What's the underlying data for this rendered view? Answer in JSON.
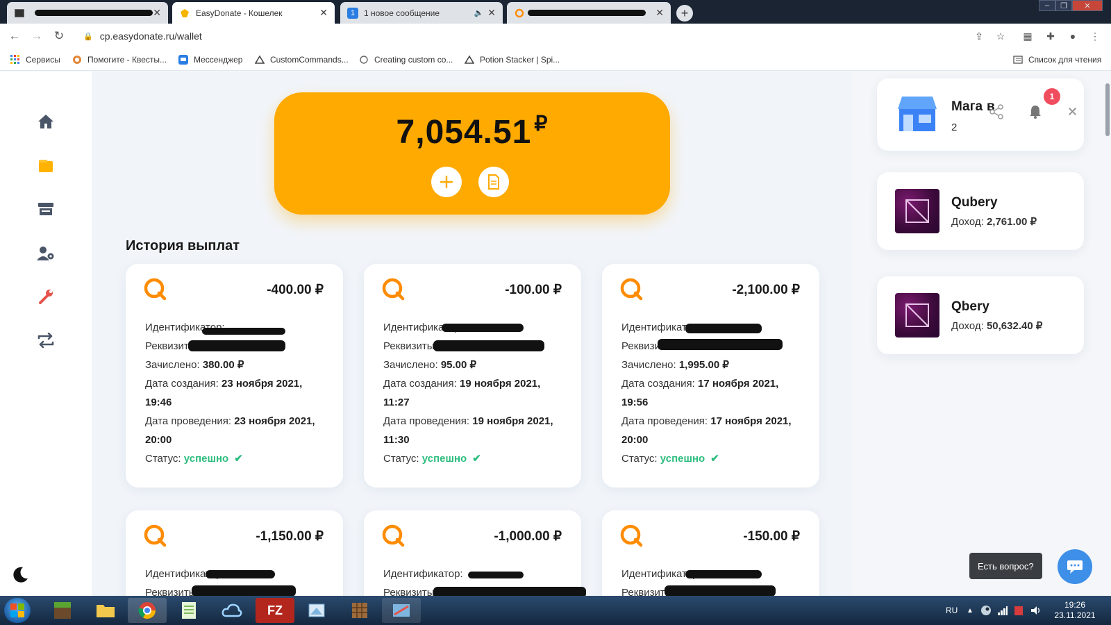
{
  "browser": {
    "tabs": [
      {
        "title": "",
        "active": false
      },
      {
        "title": "EasyDonate - Кошелек",
        "active": true
      },
      {
        "title": "1 новое сообщение",
        "active": false,
        "favicon_text": "1"
      },
      {
        "title": "",
        "active": false
      }
    ],
    "url": "cp.easydonate.ru/wallet",
    "bookmarks": [
      {
        "label": "Сервисы",
        "icon": "apps-grid-icon"
      },
      {
        "label": "Помогите - Квесты...",
        "icon": "spigot-icon"
      },
      {
        "label": "Мессенджер",
        "icon": "messenger-icon"
      },
      {
        "label": "CustomCommands...",
        "icon": "plugin-icon"
      },
      {
        "label": "Creating custom co...",
        "icon": "link-icon"
      },
      {
        "label": "Potion Stacker | Spi...",
        "icon": "plugin-icon"
      }
    ],
    "reading_list": "Список для чтения"
  },
  "sidebar": {
    "items": [
      "home-icon",
      "wallet-icon",
      "store-icon",
      "users-settings-icon",
      "wrench-icon",
      "transfer-icon"
    ],
    "active": "wallet-icon"
  },
  "wallet": {
    "balance": "7,054.51",
    "currency": "₽"
  },
  "history": {
    "title": "История выплат",
    "labels": {
      "identifier": "Идентификатор:",
      "requisites": "Реквизиты:",
      "credited": "Зачислено:",
      "created": "Дата создания:",
      "processed": "Дата проведения:",
      "status": "Статус:"
    },
    "payouts": [
      {
        "amount": "-400.00 ₽",
        "credited": "380.00 ₽",
        "created": "23 ноября 2021, 19:46",
        "processed": "23 ноября 2021, 20:00",
        "status": "успешно"
      },
      {
        "amount": "-100.00 ₽",
        "credited": "95.00 ₽",
        "created": "19 ноября 2021, 11:27",
        "processed": "19 ноября 2021, 11:30",
        "status": "успешно"
      },
      {
        "amount": "-2,100.00 ₽",
        "credited": "1,995.00 ₽",
        "created": "17 ноября 2021, 19:56",
        "processed": "17 ноября 2021, 20:00",
        "status": "успешно"
      },
      {
        "amount": "-1,150.00 ₽"
      },
      {
        "amount": "-1,000.00 ₽"
      },
      {
        "amount": "-150.00 ₽"
      }
    ]
  },
  "right_panel": {
    "shop_header": {
      "name": "Мага",
      "name_suffix": "в",
      "count": "2",
      "notifications": "1"
    },
    "shops": [
      {
        "name": "Qubery",
        "income_label": "Доход:",
        "income": "2,761.00 ₽"
      },
      {
        "name": "Qbery",
        "income_label": "Доход:",
        "income": "50,632.40 ₽"
      }
    ]
  },
  "help": {
    "label": "Есть вопрос?"
  },
  "taskbar": {
    "lang": "RU",
    "time": "19:26",
    "date": "23.11.2021"
  },
  "colors": {
    "accent": "#ffaa00",
    "success": "#2dbd7e",
    "qiwi": "#ff8c00",
    "badge": "#f04e5e",
    "chat": "#3d8fe8"
  }
}
